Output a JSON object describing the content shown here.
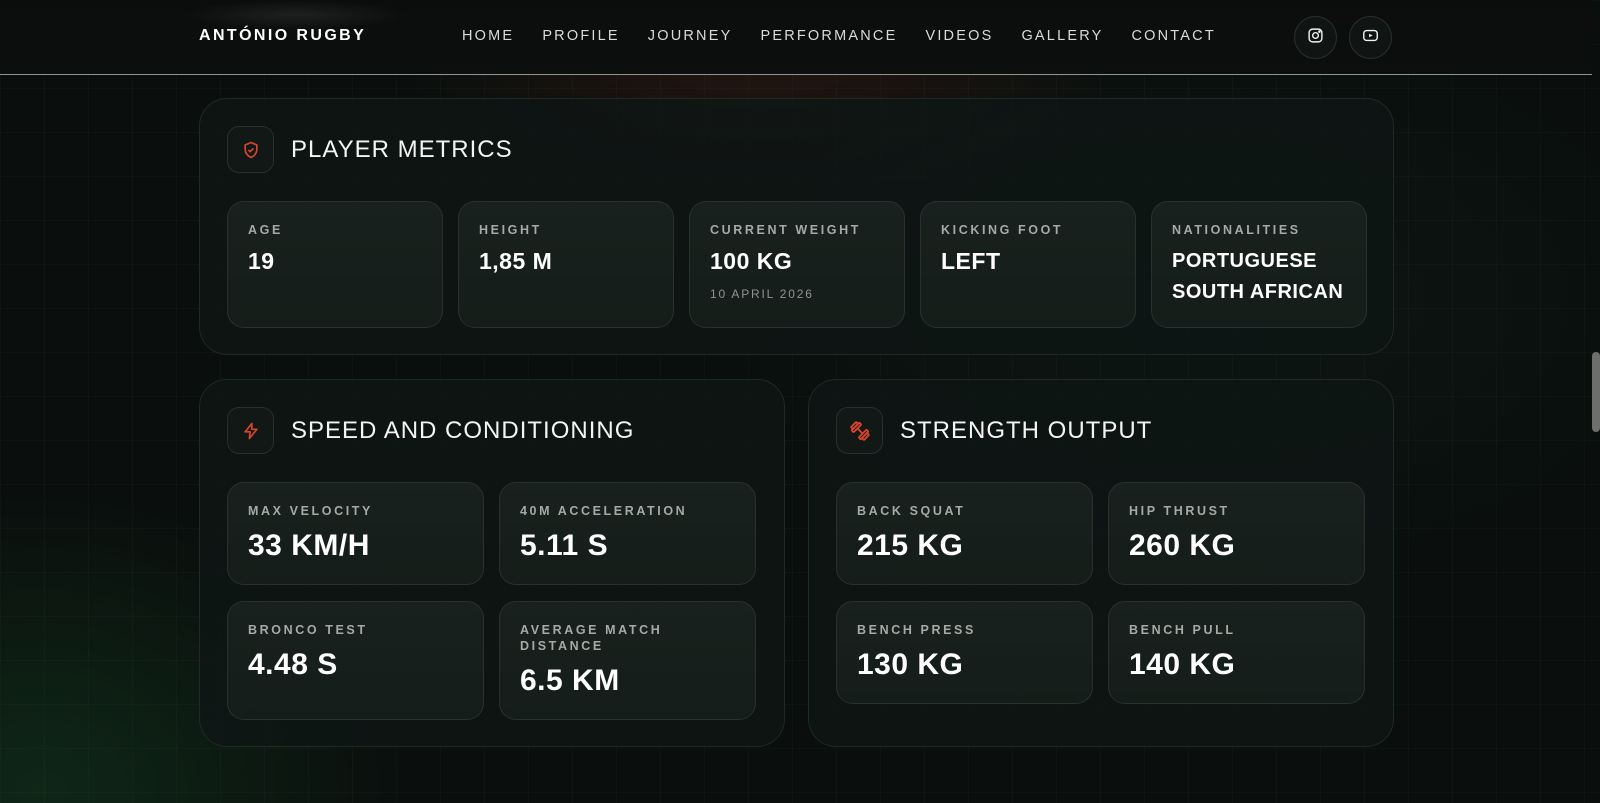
{
  "header": {
    "brand": "ANTÓNIO RUGBY",
    "nav": [
      "HOME",
      "PROFILE",
      "JOURNEY",
      "PERFORMANCE",
      "VIDEOS",
      "GALLERY",
      "CONTACT"
    ],
    "social": [
      {
        "icon": "instagram-icon"
      },
      {
        "icon": "youtube-icon"
      }
    ]
  },
  "player_metrics": {
    "title": "PLAYER METRICS",
    "icon": "shield-check-icon",
    "cards": [
      {
        "label": "AGE",
        "value": "19"
      },
      {
        "label": "HEIGHT",
        "value": "1,85 M"
      },
      {
        "label": "CURRENT WEIGHT",
        "value": "100 KG",
        "sub": "10 APRIL 2026"
      },
      {
        "label": "KICKING FOOT",
        "value": "LEFT"
      },
      {
        "label": "NATIONALITIES",
        "values": [
          "PORTUGUESE",
          "SOUTH AFRICAN"
        ]
      }
    ]
  },
  "speed": {
    "title": "SPEED AND CONDITIONING",
    "icon": "lightning-icon",
    "cards": [
      {
        "label": "MAX VELOCITY",
        "value": "33 KM/H"
      },
      {
        "label": "40M ACCELERATION",
        "value": "5.11 S"
      },
      {
        "label": "BRONCO TEST",
        "value": "4.48 S"
      },
      {
        "label": "AVERAGE MATCH DISTANCE",
        "value": "6.5 KM"
      }
    ]
  },
  "strength": {
    "title": "STRENGTH OUTPUT",
    "icon": "dumbbell-icon",
    "cards": [
      {
        "label": "BACK SQUAT",
        "value": "215 KG"
      },
      {
        "label": "HIP THRUST",
        "value": "260 KG"
      },
      {
        "label": "BENCH PRESS",
        "value": "130 KG"
      },
      {
        "label": "BENCH PULL",
        "value": "140 KG"
      }
    ]
  },
  "colors": {
    "accent": "#d9452c",
    "background": "#0a0f0d",
    "panel": "#0e1614"
  }
}
